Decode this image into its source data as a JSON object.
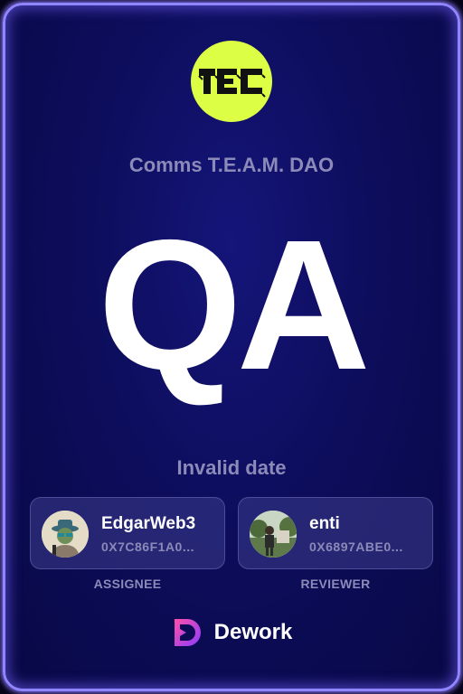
{
  "organization": {
    "logo_text": "TEC",
    "name": "Comms T.E.A.M. DAO"
  },
  "task": {
    "title": "QA",
    "date": "Invalid date"
  },
  "assignee": {
    "name": "EdgarWeb3",
    "address": "0X7C86F1A0...",
    "role": "ASSIGNEE"
  },
  "reviewer": {
    "name": "enti",
    "address": "0X6897ABE0...",
    "role": "REVIEWER"
  },
  "brand": {
    "name": "Dework",
    "icon": "dework-logo-icon"
  },
  "colors": {
    "accent_lime": "#dcff45",
    "card_border": "#8f86ff",
    "muted_text": "#8b8ab8",
    "background": "#0d0d5c"
  }
}
